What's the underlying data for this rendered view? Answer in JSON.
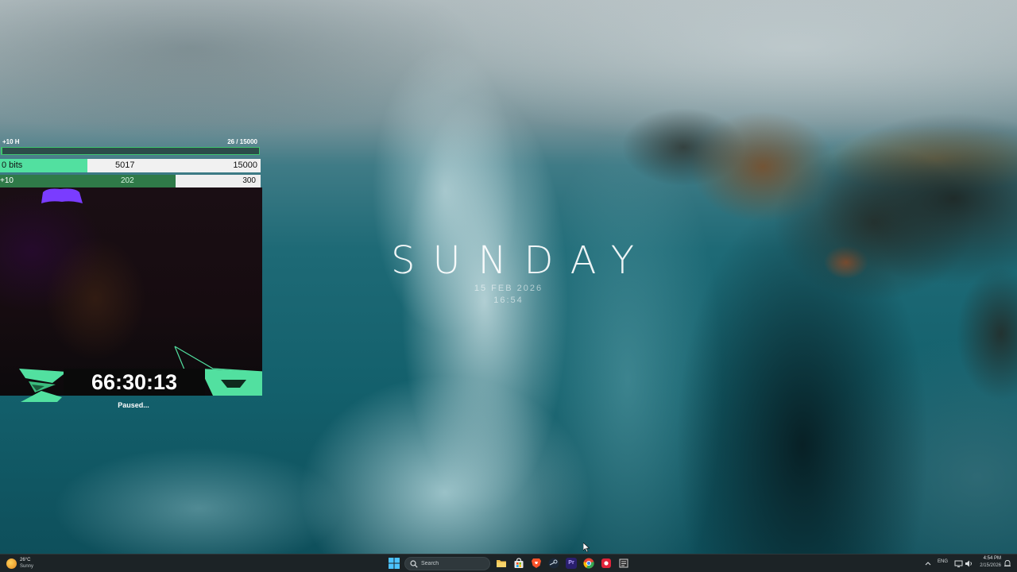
{
  "desktop_clock": {
    "day": "SUNDAY",
    "date": "15 FEB 2026",
    "time": "16:54"
  },
  "overlay": {
    "top_left_label": "+10 H",
    "top_right_label": "26  / 15000",
    "top_progress": 0.0017,
    "bits_bar": {
      "left": "0 bits",
      "middle": "5017",
      "right": "15000",
      "progress": 0.3345
    },
    "sub_bar": {
      "left": "+10",
      "middle": "202",
      "right": "300",
      "progress": 0.6733
    },
    "timer": "66:30:13",
    "status": "Paused...",
    "accent_color": "#52e0a0",
    "purple_color": "#7a3cff"
  },
  "taskbar": {
    "weather": {
      "temp": "26°C",
      "condition": "Sunny",
      "icon": "sun-icon"
    },
    "search_placeholder": "Search",
    "apps": [
      {
        "name": "file-explorer",
        "icon": "folder-icon",
        "color": "#f2c14e"
      },
      {
        "name": "microsoft-store",
        "icon": "store-icon",
        "color": "#e7e7e7"
      },
      {
        "name": "brave-browser",
        "icon": "lion-icon",
        "color": "#fb542b"
      },
      {
        "name": "steam",
        "icon": "steam-icon",
        "color": "#c7d5e0"
      },
      {
        "name": "premiere-pro",
        "icon": "premiere-icon",
        "color": "#2a1f6e"
      },
      {
        "name": "google-chrome",
        "icon": "chrome-icon",
        "color": "#34a853"
      },
      {
        "name": "red-app",
        "icon": "red-app-icon",
        "color": "#e0243a"
      },
      {
        "name": "media-app",
        "icon": "media-icon",
        "color": "#cfcfcf"
      }
    ],
    "premiere_label": "Pr",
    "language": "ENG",
    "clock_time": "4:54 PM",
    "clock_date": "2/15/2026"
  }
}
